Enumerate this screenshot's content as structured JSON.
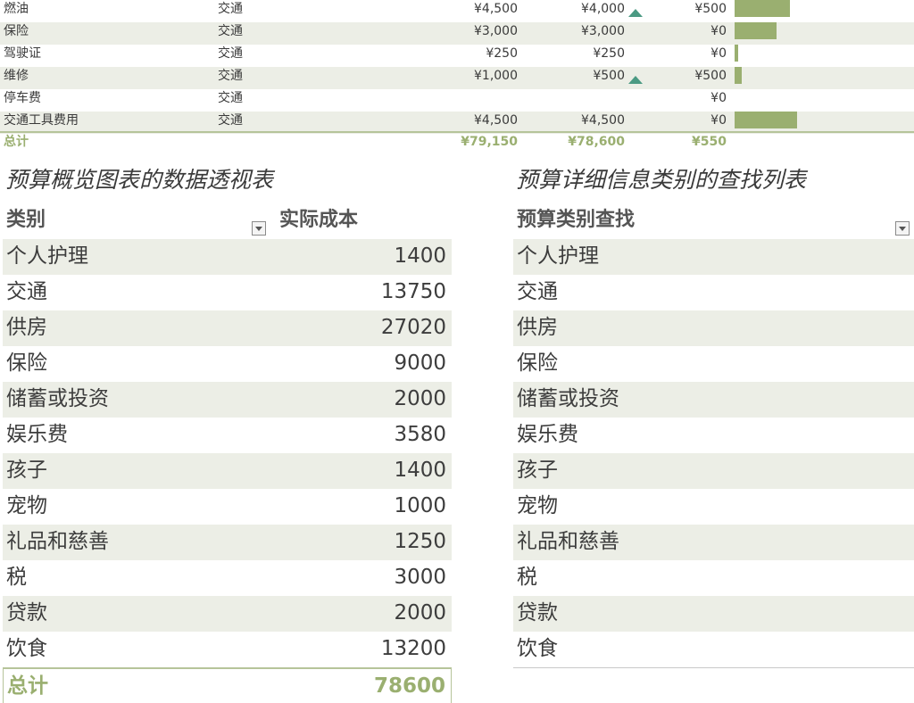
{
  "detail": {
    "rows": [
      {
        "item": "燃油",
        "category": "交通",
        "estimated": "¥4,500",
        "actual": "¥4,000",
        "trend_up": true,
        "difference": "¥500",
        "bar_fraction": 0.057
      },
      {
        "item": "保险",
        "category": "交通",
        "estimated": "¥3,000",
        "actual": "¥3,000",
        "trend_up": false,
        "difference": "¥0",
        "bar_fraction": 0.043
      },
      {
        "item": "驾驶证",
        "category": "交通",
        "estimated": "¥250",
        "actual": "¥250",
        "trend_up": false,
        "difference": "¥0",
        "bar_fraction": 0.004
      },
      {
        "item": "维修",
        "category": "交通",
        "estimated": "¥1,000",
        "actual": "¥500",
        "trend_up": true,
        "difference": "¥500",
        "bar_fraction": 0.007
      },
      {
        "item": "停车费",
        "category": "交通",
        "estimated": "",
        "actual": "",
        "trend_up": false,
        "difference": "¥0",
        "bar_fraction": 0
      },
      {
        "item": "交通工具费用",
        "category": "交通",
        "estimated": "¥4,500",
        "actual": "¥4,500",
        "trend_up": false,
        "difference": "¥0",
        "bar_fraction": 0.064
      }
    ],
    "total": {
      "label": "总计",
      "estimated": "¥79,150",
      "actual": "¥78,600",
      "difference": "¥550"
    }
  },
  "pivot": {
    "title": "预算概览图表的数据透视表",
    "header_category": "类别",
    "header_actual": "实际成本",
    "rows": [
      {
        "category": "个人护理",
        "value": "1400"
      },
      {
        "category": "交通",
        "value": "13750"
      },
      {
        "category": "供房",
        "value": "27020"
      },
      {
        "category": "保险",
        "value": "9000"
      },
      {
        "category": "储蓄或投资",
        "value": "2000"
      },
      {
        "category": "娱乐费",
        "value": "3580"
      },
      {
        "category": "孩子",
        "value": "1400"
      },
      {
        "category": "宠物",
        "value": "1000"
      },
      {
        "category": "礼品和慈善",
        "value": "1250"
      },
      {
        "category": "税",
        "value": "3000"
      },
      {
        "category": "贷款",
        "value": "2000"
      },
      {
        "category": "饮食",
        "value": "13200"
      }
    ],
    "total": {
      "label": "总计",
      "value": "78600"
    }
  },
  "lookup": {
    "title": "预算详细信息类别的查找列表",
    "header": "预算类别查找",
    "items": [
      "个人护理",
      "交通",
      "供房",
      "保险",
      "储蓄或投资",
      "娱乐费",
      "孩子",
      "宠物",
      "礼品和慈善",
      "税",
      "贷款",
      "饮食"
    ]
  },
  "colors": {
    "accent": "#9aaf70",
    "row_shade": "#eceee6",
    "trend_icon": "#4b9a83"
  }
}
